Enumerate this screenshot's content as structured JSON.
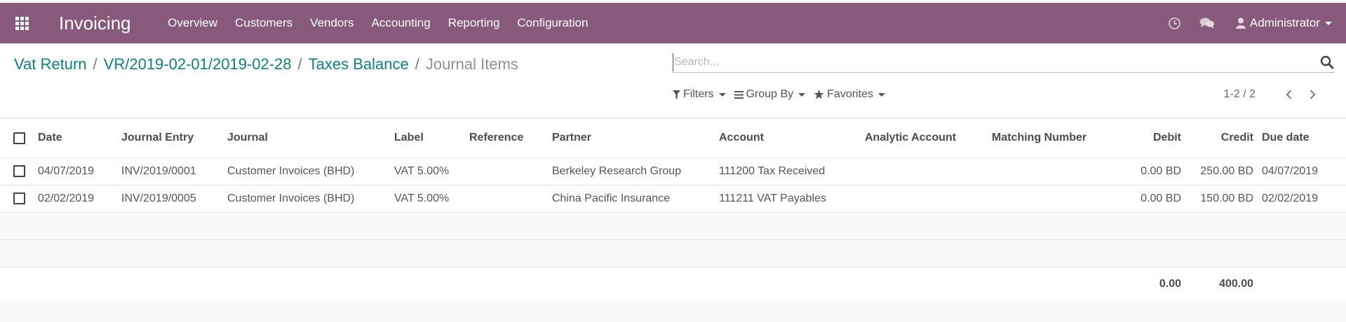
{
  "app": {
    "title": "Invoicing"
  },
  "menu": [
    "Overview",
    "Customers",
    "Vendors",
    "Accounting",
    "Reporting",
    "Configuration"
  ],
  "user": {
    "name": "Administrator"
  },
  "breadcrumb": {
    "items": [
      "Vat Return",
      "VR/2019-02-01/2019-02-28",
      "Taxes Balance"
    ],
    "separator": "/",
    "current": "Journal Items"
  },
  "search": {
    "placeholder": "Search..."
  },
  "filters": {
    "filters_label": "Filters",
    "groupby_label": "Group By",
    "favorites_label": "Favorites"
  },
  "pager": {
    "value": "1-2 / 2"
  },
  "table": {
    "columns": [
      "Date",
      "Journal Entry",
      "Journal",
      "Label",
      "Reference",
      "Partner",
      "Account",
      "Analytic Account",
      "Matching Number",
      "Debit",
      "Credit",
      "Due date"
    ],
    "rows": [
      [
        "04/07/2019",
        "INV/2019/0001",
        "Customer Invoices (BHD)",
        "VAT 5.00%",
        "",
        "Berkeley Research Group",
        "111200 Tax Received",
        "",
        "",
        "0.00 BD",
        "250.00 BD",
        "04/07/2019"
      ],
      [
        "02/02/2019",
        "INV/2019/0005",
        "Customer Invoices (BHD)",
        "VAT 5.00%",
        "",
        "China Pacific Insurance",
        "111211 VAT Payables",
        "",
        "",
        "0.00 BD",
        "150.00 BD",
        "02/02/2019"
      ]
    ],
    "totals": {
      "debit": "0.00",
      "credit": "400.00"
    }
  },
  "colors": {
    "navbar": "#875a7b",
    "link": "#0e8080"
  }
}
